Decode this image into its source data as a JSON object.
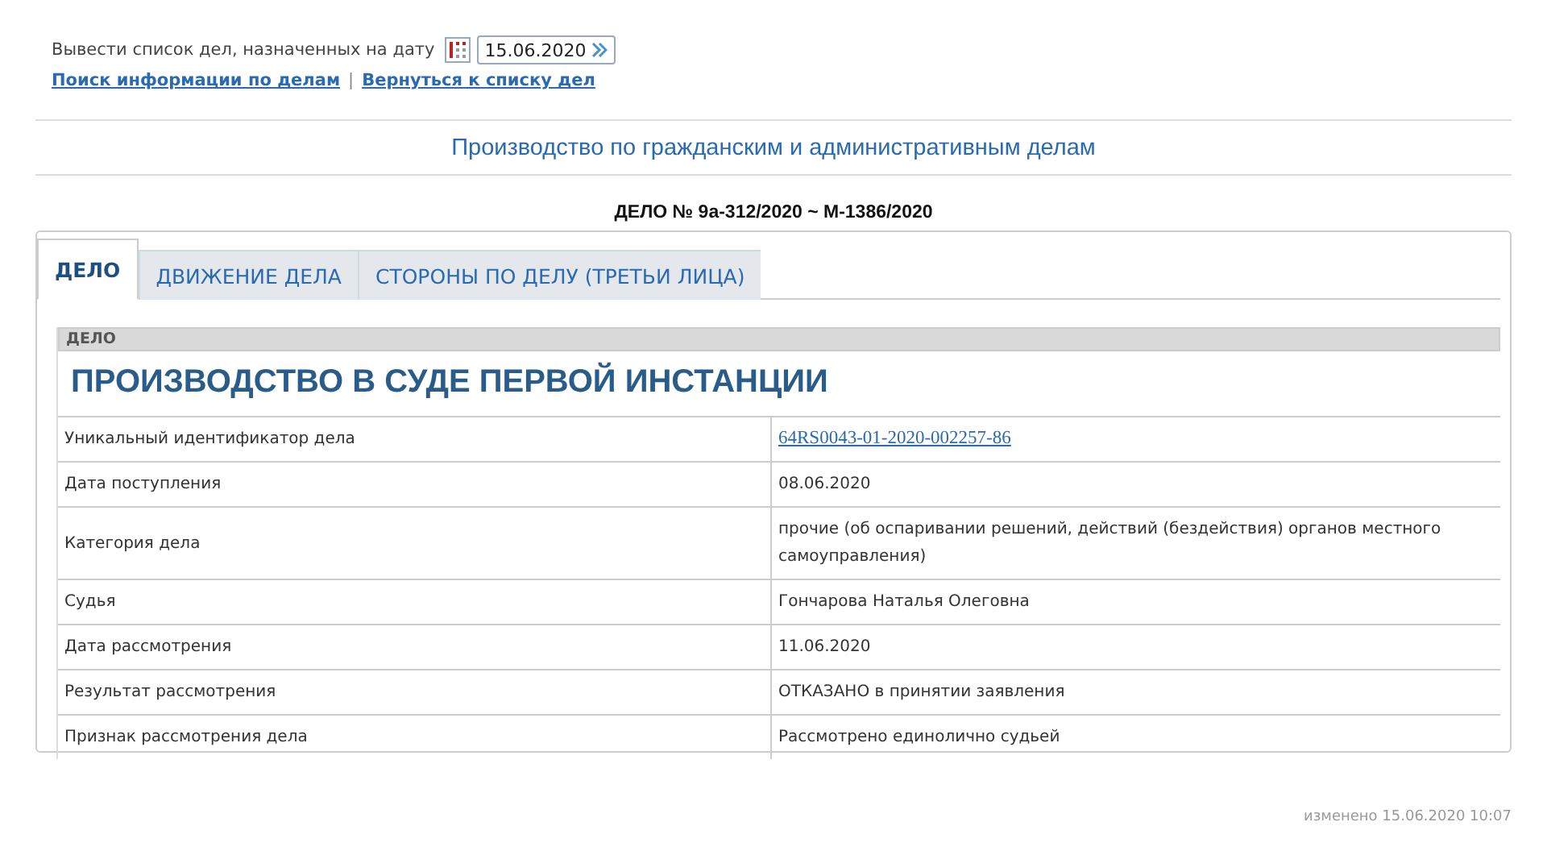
{
  "date_filter": {
    "label": "Вывести список дел, назначенных на дату",
    "value": "15.06.2020"
  },
  "links": [
    {
      "label": "Поиск информации по делам"
    },
    {
      "label": "Вернуться к списку дел"
    }
  ],
  "links_separator": "|",
  "page_title": "Производство по гражданским и административным делам",
  "case_number": "ДЕЛО № 9а-312/2020 ~ М-1386/2020",
  "tabs": [
    {
      "label": "ДЕЛО",
      "selected": true
    },
    {
      "label": "ДВИЖЕНИЕ ДЕЛА",
      "selected": false
    },
    {
      "label": "СТОРОНЫ ПО ДЕЛУ (ТРЕТЬИ ЛИЦА)",
      "selected": false
    }
  ],
  "section": {
    "header": "ДЕЛО",
    "heading": "ПРОИЗВОДСТВО В СУДЕ ПЕРВОЙ ИНСТАНЦИИ"
  },
  "rows": [
    {
      "label": "Уникальный идентификатор дела",
      "value": "64RS0043-01-2020-002257-86",
      "kind": "link"
    },
    {
      "label": "Дата поступления",
      "value": "08.06.2020",
      "kind": "text"
    },
    {
      "label": "Категория дела",
      "value": "прочие (об оспаривании решений, действий (бездействия) органов местного самоуправления)",
      "kind": "text"
    },
    {
      "label": "Судья",
      "value": "Гончарова Наталья Олеговна",
      "kind": "text"
    },
    {
      "label": "Дата рассмотрения",
      "value": "11.06.2020",
      "kind": "text"
    },
    {
      "label": "Результат рассмотрения",
      "value": "ОТКАЗАНО в принятии заявления",
      "kind": "text"
    },
    {
      "label": "Признак рассмотрения дела",
      "value": "Рассмотрено единолично судьей",
      "kind": "text"
    }
  ],
  "footer": "изменено 15.06.2020 10:07"
}
